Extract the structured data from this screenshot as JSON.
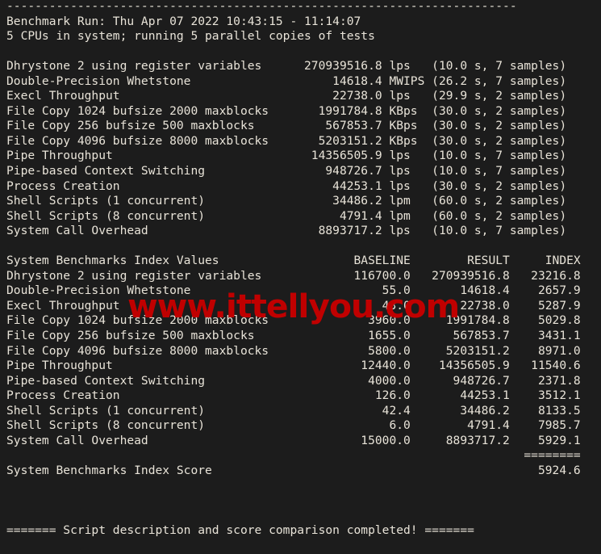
{
  "terminal": {
    "background_color": "#1c1c1c",
    "text_color": "#e8e3d8",
    "separator_top": "------------------------------------------------------------------------",
    "run_header": "Benchmark Run: Thu Apr 07 2022 10:43:15 - 11:14:07",
    "cpu_header": "5 CPUs in system; running 5 parallel copies of tests",
    "footer": "======= Script description and score comparison completed! ======="
  },
  "watermark": {
    "text": "www.ittellyou.com",
    "color": "#c00000"
  },
  "raw_results": {
    "rows": [
      {
        "name": "Dhrystone 2 using register variables",
        "value": "270939516.8",
        "unit": "lps",
        "timing": "(10.0 s, 7 samples)"
      },
      {
        "name": "Double-Precision Whetstone",
        "value": "14618.4",
        "unit": "MWIPS",
        "timing": "(26.2 s, 7 samples)"
      },
      {
        "name": "Execl Throughput",
        "value": "22738.0",
        "unit": "lps",
        "timing": "(29.9 s, 2 samples)"
      },
      {
        "name": "File Copy 1024 bufsize 2000 maxblocks",
        "value": "1991784.8",
        "unit": "KBps",
        "timing": "(30.0 s, 2 samples)"
      },
      {
        "name": "File Copy 256 bufsize 500 maxblocks",
        "value": "567853.7",
        "unit": "KBps",
        "timing": "(30.0 s, 2 samples)"
      },
      {
        "name": "File Copy 4096 bufsize 8000 maxblocks",
        "value": "5203151.2",
        "unit": "KBps",
        "timing": "(30.0 s, 2 samples)"
      },
      {
        "name": "Pipe Throughput",
        "value": "14356505.9",
        "unit": "lps",
        "timing": "(10.0 s, 7 samples)"
      },
      {
        "name": "Pipe-based Context Switching",
        "value": "948726.7",
        "unit": "lps",
        "timing": "(10.0 s, 7 samples)"
      },
      {
        "name": "Process Creation",
        "value": "44253.1",
        "unit": "lps",
        "timing": "(30.0 s, 2 samples)"
      },
      {
        "name": "Shell Scripts (1 concurrent)",
        "value": "34486.2",
        "unit": "lpm",
        "timing": "(60.0 s, 2 samples)"
      },
      {
        "name": "Shell Scripts (8 concurrent)",
        "value": "4791.4",
        "unit": "lpm",
        "timing": "(60.0 s, 2 samples)"
      },
      {
        "name": "System Call Overhead",
        "value": "8893717.2",
        "unit": "lps",
        "timing": "(10.0 s, 7 samples)"
      }
    ]
  },
  "index_table": {
    "title": "System Benchmarks Index Values",
    "columns": [
      "BASELINE",
      "RESULT",
      "INDEX"
    ],
    "rows": [
      {
        "name": "Dhrystone 2 using register variables",
        "baseline": "116700.0",
        "result": "270939516.8",
        "index": "23216.8"
      },
      {
        "name": "Double-Precision Whetstone",
        "baseline": "55.0",
        "result": "14618.4",
        "index": "2657.9"
      },
      {
        "name": "Execl Throughput",
        "baseline": "43.0",
        "result": "22738.0",
        "index": "5287.9"
      },
      {
        "name": "File Copy 1024 bufsize 2000 maxblocks",
        "baseline": "3960.0",
        "result": "1991784.8",
        "index": "5029.8"
      },
      {
        "name": "File Copy 256 bufsize 500 maxblocks",
        "baseline": "1655.0",
        "result": "567853.7",
        "index": "3431.1"
      },
      {
        "name": "File Copy 4096 bufsize 8000 maxblocks",
        "baseline": "5800.0",
        "result": "5203151.2",
        "index": "8971.0"
      },
      {
        "name": "Pipe Throughput",
        "baseline": "12440.0",
        "result": "14356505.9",
        "index": "11540.6"
      },
      {
        "name": "Pipe-based Context Switching",
        "baseline": "4000.0",
        "result": "948726.7",
        "index": "2371.8"
      },
      {
        "name": "Process Creation",
        "baseline": "126.0",
        "result": "44253.1",
        "index": "3512.1"
      },
      {
        "name": "Shell Scripts (1 concurrent)",
        "baseline": "42.4",
        "result": "34486.2",
        "index": "8133.5"
      },
      {
        "name": "Shell Scripts (8 concurrent)",
        "baseline": "6.0",
        "result": "4791.4",
        "index": "7985.7"
      },
      {
        "name": "System Call Overhead",
        "baseline": "15000.0",
        "result": "8893717.2",
        "index": "5929.1"
      }
    ],
    "score_rule": "========",
    "score_label": "System Benchmarks Index Score",
    "score_value": "5924.6"
  }
}
